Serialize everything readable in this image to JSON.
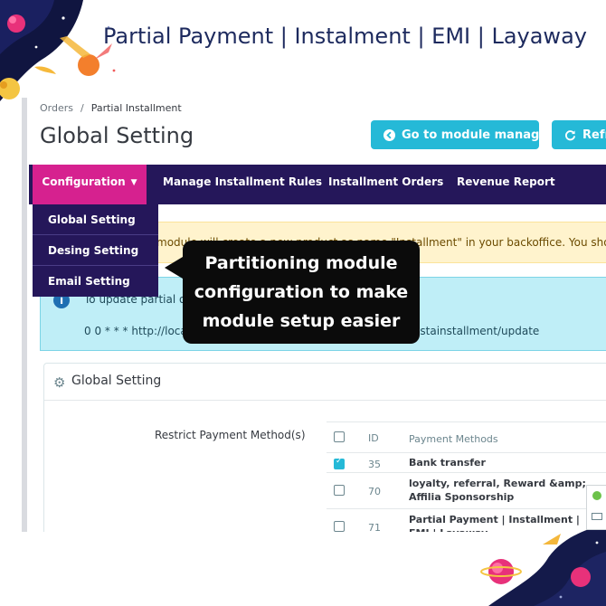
{
  "banner": {
    "title": "Partial Payment | Instalment | EMI | Layaway"
  },
  "breadcrumb": {
    "parent": "Orders",
    "separator": "/",
    "current": "Partial Installment"
  },
  "page": {
    "title": "Global Setting"
  },
  "toolbar": {
    "module_manager_label": "Go to module manager",
    "refresh_label": "Refr"
  },
  "nav": {
    "items": [
      {
        "label": "Configuration",
        "active": true
      },
      {
        "label": "Manage Installment Rules"
      },
      {
        "label": "Installment Orders"
      },
      {
        "label": "Revenue Report"
      }
    ]
  },
  "dropdown": {
    "items": [
      {
        "label": "Global Setting"
      },
      {
        "label": "Desing Setting"
      },
      {
        "label": "Email Setting"
      }
    ]
  },
  "alerts": {
    "warning_text": "module will create a new product as name \"Installment\" in your backoffice. You should n",
    "info_line1": "To update partial o",
    "info_line2_left": "0 0 * * * http://loca",
    "info_line2_right": "estainstallment/update"
  },
  "callout": {
    "text": "Partitioning module configuration to make module setup easier"
  },
  "panel": {
    "title": "Global Setting",
    "restrict_label": "Restrict Payment Method(s)",
    "table": {
      "headers": {
        "id": "ID",
        "name": "Payment Methods"
      },
      "rows": [
        {
          "id": "35",
          "name": "Bank transfer",
          "checked": true
        },
        {
          "id": "70",
          "name": "loyalty, referral, Reward &amp; Affilia Sponsorship",
          "checked": false
        },
        {
          "id": "71",
          "name": "Partial Payment | Installment | EMI | Layaway",
          "checked": false
        }
      ]
    }
  },
  "colors": {
    "nav_bg": "#25175a",
    "nav_active": "#d6218f",
    "button": "#25b9d7",
    "banner_title": "#1d2a5e",
    "callout_bg": "#0b0b0b"
  },
  "icons": {
    "module_button": "arrow-circle-left-icon",
    "refresh_button": "refresh-icon",
    "panel_heading": "gear-icon",
    "info_alert": "info-icon",
    "dropdown_toggle": "caret-down-icon"
  }
}
